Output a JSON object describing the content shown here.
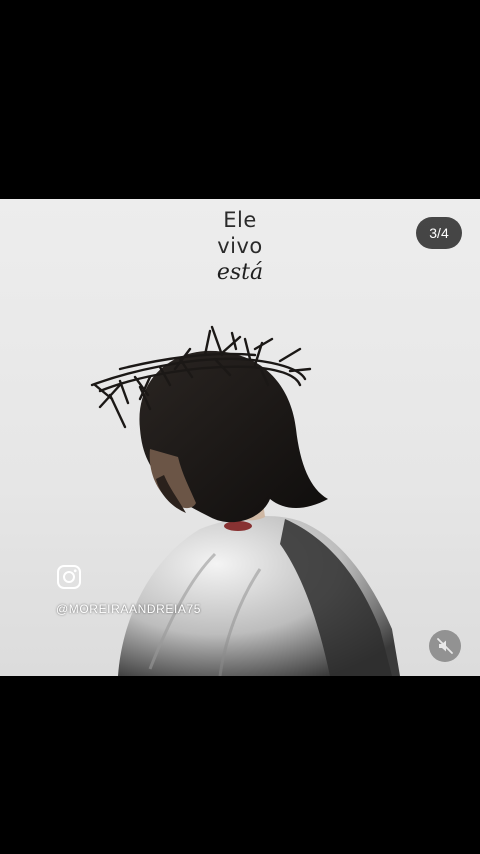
{
  "post": {
    "title_line1": "Ele",
    "title_line2": "vivo",
    "title_line3": "está",
    "counter": "3/4",
    "social_icon": "instagram-icon",
    "handle": "@MOREIRAANDREIA75",
    "mute_icon": "speaker-muted-icon"
  },
  "colors": {
    "background": "#000000",
    "post_background": "#e8e8e8",
    "counter_bg": "#282828",
    "text": "#2b2b2b"
  }
}
